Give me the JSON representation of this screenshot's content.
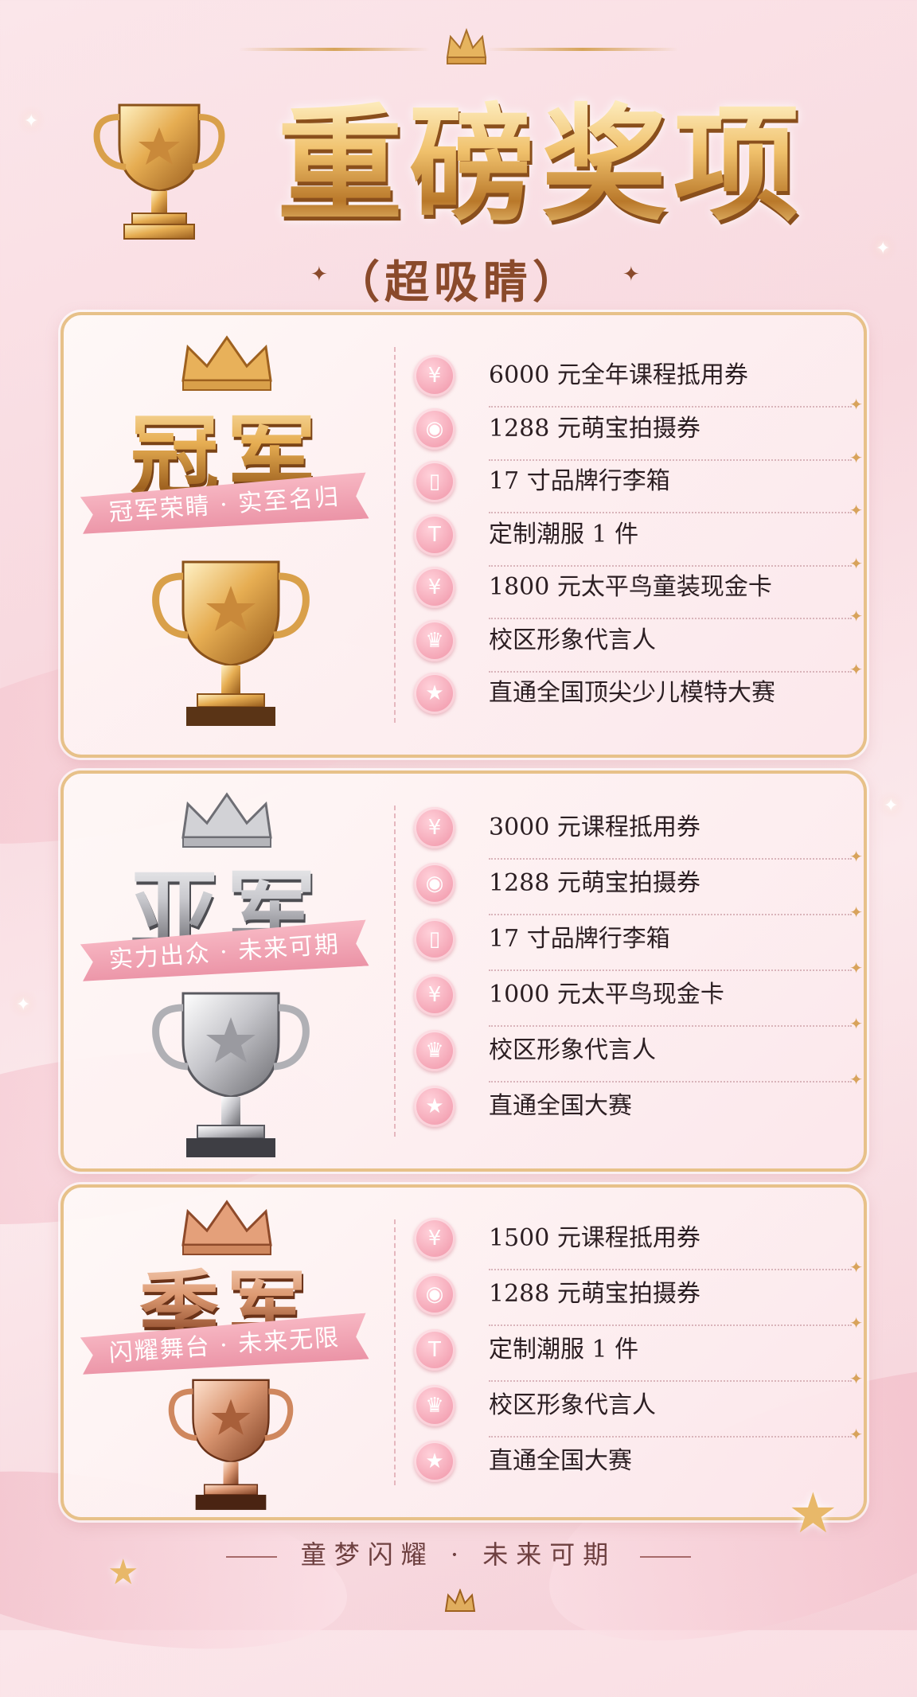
{
  "header": {
    "title": "重磅奖项",
    "subtitle": "（超吸睛）",
    "star_left": "✦",
    "star_right": "✦"
  },
  "colors": {
    "gold": "#e3a84a",
    "pink": "#ef8fa3",
    "silver": "#b9b9be",
    "bronze": "#c47a52"
  },
  "cards": [
    {
      "rank": "冠军",
      "ribbon": "冠军荣睛 · 实至名归",
      "trophy": "gold-trophy",
      "items": [
        {
          "icon": "ticket-icon",
          "glyph": "¥",
          "label": "6000 元全年课程抵用券"
        },
        {
          "icon": "camera-icon",
          "glyph": "◉",
          "label": "1288 元萌宝拍摄券"
        },
        {
          "icon": "suitcase-icon",
          "glyph": "▯",
          "label": "17 寸品牌行李箱"
        },
        {
          "icon": "tshirt-icon",
          "glyph": "T",
          "label": "定制潮服 1 件"
        },
        {
          "icon": "card-icon",
          "glyph": "¥",
          "label": "1800 元太平鸟童装现金卡"
        },
        {
          "icon": "crown-icon",
          "glyph": "♛",
          "label": "校区形象代言人"
        },
        {
          "icon": "star-icon",
          "glyph": "★",
          "label": "直通全国顶尖少儿模特大赛"
        }
      ]
    },
    {
      "rank": "亚军",
      "ribbon": "实力出众 · 未来可期",
      "trophy": "silver-trophy",
      "items": [
        {
          "icon": "ticket-icon",
          "glyph": "¥",
          "label": "3000 元课程抵用券"
        },
        {
          "icon": "camera-icon",
          "glyph": "◉",
          "label": "1288 元萌宝拍摄券"
        },
        {
          "icon": "suitcase-icon",
          "glyph": "▯",
          "label": "17 寸品牌行李箱"
        },
        {
          "icon": "card-icon",
          "glyph": "¥",
          "label": "1000 元太平鸟现金卡"
        },
        {
          "icon": "crown-icon",
          "glyph": "♛",
          "label": "校区形象代言人"
        },
        {
          "icon": "star-icon",
          "glyph": "★",
          "label": "直通全国大赛"
        }
      ]
    },
    {
      "rank": "季军",
      "ribbon": "闪耀舞台 · 未来无限",
      "trophy": "bronze-trophy",
      "items": [
        {
          "icon": "ticket-icon",
          "glyph": "¥",
          "label": "1500 元课程抵用券"
        },
        {
          "icon": "camera-icon",
          "glyph": "◉",
          "label": "1288 元萌宝拍摄券"
        },
        {
          "icon": "tshirt-icon",
          "glyph": "T",
          "label": "定制潮服 1 件"
        },
        {
          "icon": "crown-icon",
          "glyph": "♛",
          "label": "校区形象代言人"
        },
        {
          "icon": "star-icon",
          "glyph": "★",
          "label": "直通全国大赛"
        }
      ]
    }
  ],
  "footer": {
    "slogan": "童梦闪耀 · 未来可期"
  }
}
